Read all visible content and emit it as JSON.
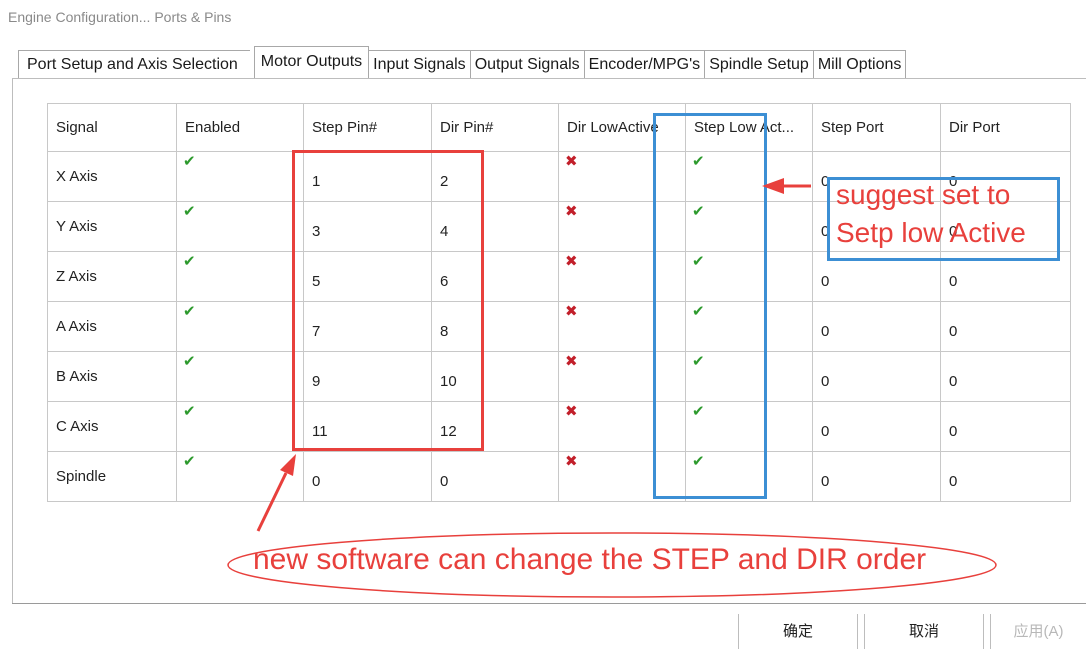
{
  "window": {
    "title": "Engine Configuration... Ports & Pins"
  },
  "tabs": [
    {
      "label": "Port Setup and Axis Selection"
    },
    {
      "label": "Motor Outputs"
    },
    {
      "label": "Input Signals"
    },
    {
      "label": "Output Signals"
    },
    {
      "label": "Encoder/MPG's"
    },
    {
      "label": "Spindle Setup"
    },
    {
      "label": "Mill Options"
    }
  ],
  "active_tab": "Motor Outputs",
  "table": {
    "headers": [
      "Signal",
      "Enabled",
      "Step Pin#",
      "Dir Pin#",
      "Dir LowActive",
      "Step Low Act...",
      "Step Port",
      "Dir Port"
    ],
    "rows": [
      {
        "signal": "X Axis",
        "enabled": "check",
        "step_pin": "1",
        "dir_pin": "2",
        "dir_low_active": "cross",
        "step_low_active": "check",
        "step_port": "0",
        "dir_port": "0"
      },
      {
        "signal": "Y Axis",
        "enabled": "check",
        "step_pin": "3",
        "dir_pin": "4",
        "dir_low_active": "cross",
        "step_low_active": "check",
        "step_port": "0",
        "dir_port": "0"
      },
      {
        "signal": "Z Axis",
        "enabled": "check",
        "step_pin": "5",
        "dir_pin": "6",
        "dir_low_active": "cross",
        "step_low_active": "check",
        "step_port": "0",
        "dir_port": "0"
      },
      {
        "signal": "A Axis",
        "enabled": "check",
        "step_pin": "7",
        "dir_pin": "8",
        "dir_low_active": "cross",
        "step_low_active": "check",
        "step_port": "0",
        "dir_port": "0"
      },
      {
        "signal": "B Axis",
        "enabled": "check",
        "step_pin": "9",
        "dir_pin": "10",
        "dir_low_active": "cross",
        "step_low_active": "check",
        "step_port": "0",
        "dir_port": "0"
      },
      {
        "signal": "C Axis",
        "enabled": "check",
        "step_pin": "11",
        "dir_pin": "12",
        "dir_low_active": "cross",
        "step_low_active": "check",
        "step_port": "0",
        "dir_port": "0"
      },
      {
        "signal": "Spindle",
        "enabled": "check",
        "step_pin": "0",
        "dir_pin": "0",
        "dir_low_active": "cross",
        "step_low_active": "check",
        "step_port": "0",
        "dir_port": "0"
      }
    ]
  },
  "icons": {
    "check": "green-check-icon",
    "cross": "red-cross-icon"
  },
  "glyphs": {
    "check": "✔",
    "cross": "✖"
  },
  "buttons": {
    "ok": "确定",
    "cancel": "取消",
    "apply": "应用(A)"
  },
  "annotations": {
    "suggest": [
      "suggest set to",
      "Setp low Active"
    ],
    "bottom_note": "new software can change the STEP and DIR  order"
  },
  "colors": {
    "annotation_red": "#e8403c",
    "annotation_blue": "#3c8fd4",
    "check_green": "#2d9a2d",
    "cross_red": "#c21f2a"
  }
}
